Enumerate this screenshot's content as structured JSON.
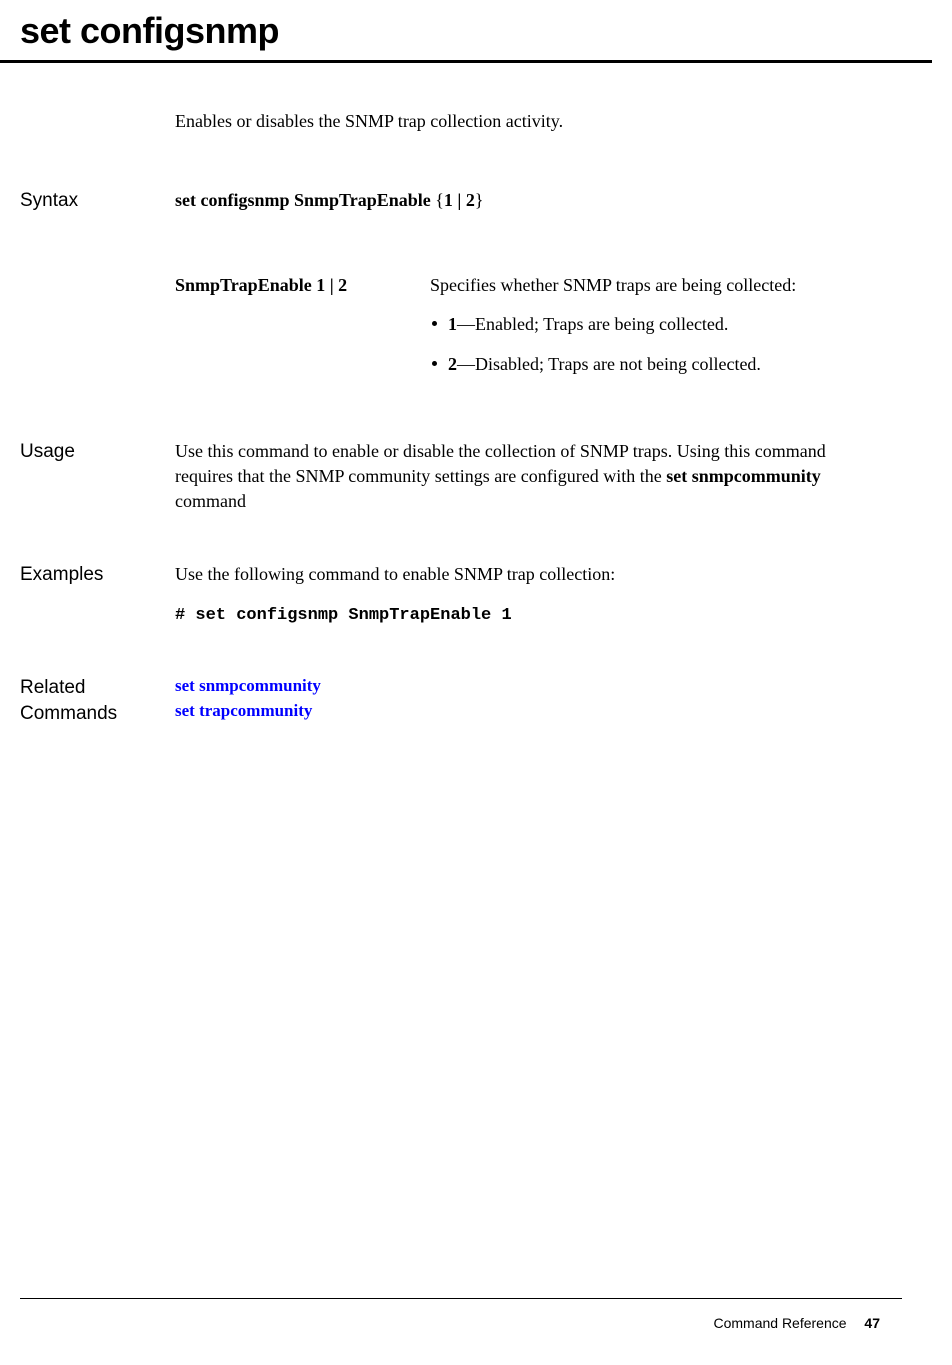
{
  "title": "set configsnmp",
  "intro": "Enables or disables the SNMP trap collection activity.",
  "sections": {
    "syntax": {
      "label": "Syntax",
      "command_prefix": "set configsnmp SnmpTrapEnable ",
      "brace_open": "{",
      "options": "1 | 2",
      "brace_close": "}",
      "param": {
        "name": "SnmpTrapEnable 1 | 2",
        "desc": "Specifies whether SNMP traps are being collected:",
        "bullets": [
          {
            "bold": "1",
            "text": "—Enabled; Traps are being collected."
          },
          {
            "bold": "2",
            "text": "—Disabled; Traps are not being collected."
          }
        ]
      }
    },
    "usage": {
      "label": "Usage",
      "pre": "Use this command to enable or disable the collection of SNMP traps. Using this command requires that the SNMP community settings are configured with the ",
      "bold": "set snmpcommunity",
      "post": " command"
    },
    "examples": {
      "label": "Examples",
      "text": "Use the following command to enable SNMP trap collection:",
      "code": "# set configsnmp SnmpTrapEnable 1"
    },
    "related": {
      "label": "Related Commands",
      "links": [
        "set snmpcommunity",
        "set trapcommunity"
      ]
    }
  },
  "footer": {
    "text": "Command Reference",
    "page": "47"
  }
}
